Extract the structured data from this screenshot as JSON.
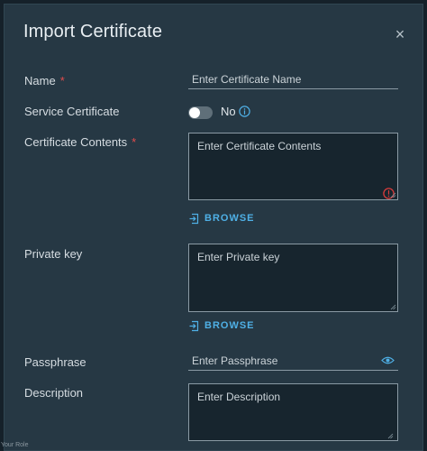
{
  "dialog": {
    "title": "Import Certificate",
    "close_glyph": "×"
  },
  "fields": {
    "name": {
      "label": "Name",
      "required_mark": "*",
      "placeholder": "Enter Certificate Name",
      "value": ""
    },
    "service_certificate": {
      "label": "Service Certificate",
      "state": "No",
      "enabled": false
    },
    "certificate_contents": {
      "label": "Certificate Contents",
      "required_mark": "*",
      "placeholder": "Enter Certificate Contents",
      "value": "",
      "browse_label": "BROWSE"
    },
    "private_key": {
      "label": "Private key",
      "placeholder": "Enter Private key",
      "value": "",
      "browse_label": "BROWSE"
    },
    "passphrase": {
      "label": "Passphrase",
      "placeholder": "Enter Passphrase",
      "value": ""
    },
    "description": {
      "label": "Description",
      "placeholder": "Enter Description",
      "value": ""
    }
  },
  "icons": {
    "info": "info-icon",
    "error": "error-icon",
    "browse": "file-upload-icon",
    "eye": "eye-icon",
    "close": "close-icon"
  },
  "colors": {
    "modal_bg": "#263844",
    "accent": "#4fb0e6",
    "required": "#e24c4c",
    "error": "#d93b3b"
  },
  "footer_text": "Your Role"
}
